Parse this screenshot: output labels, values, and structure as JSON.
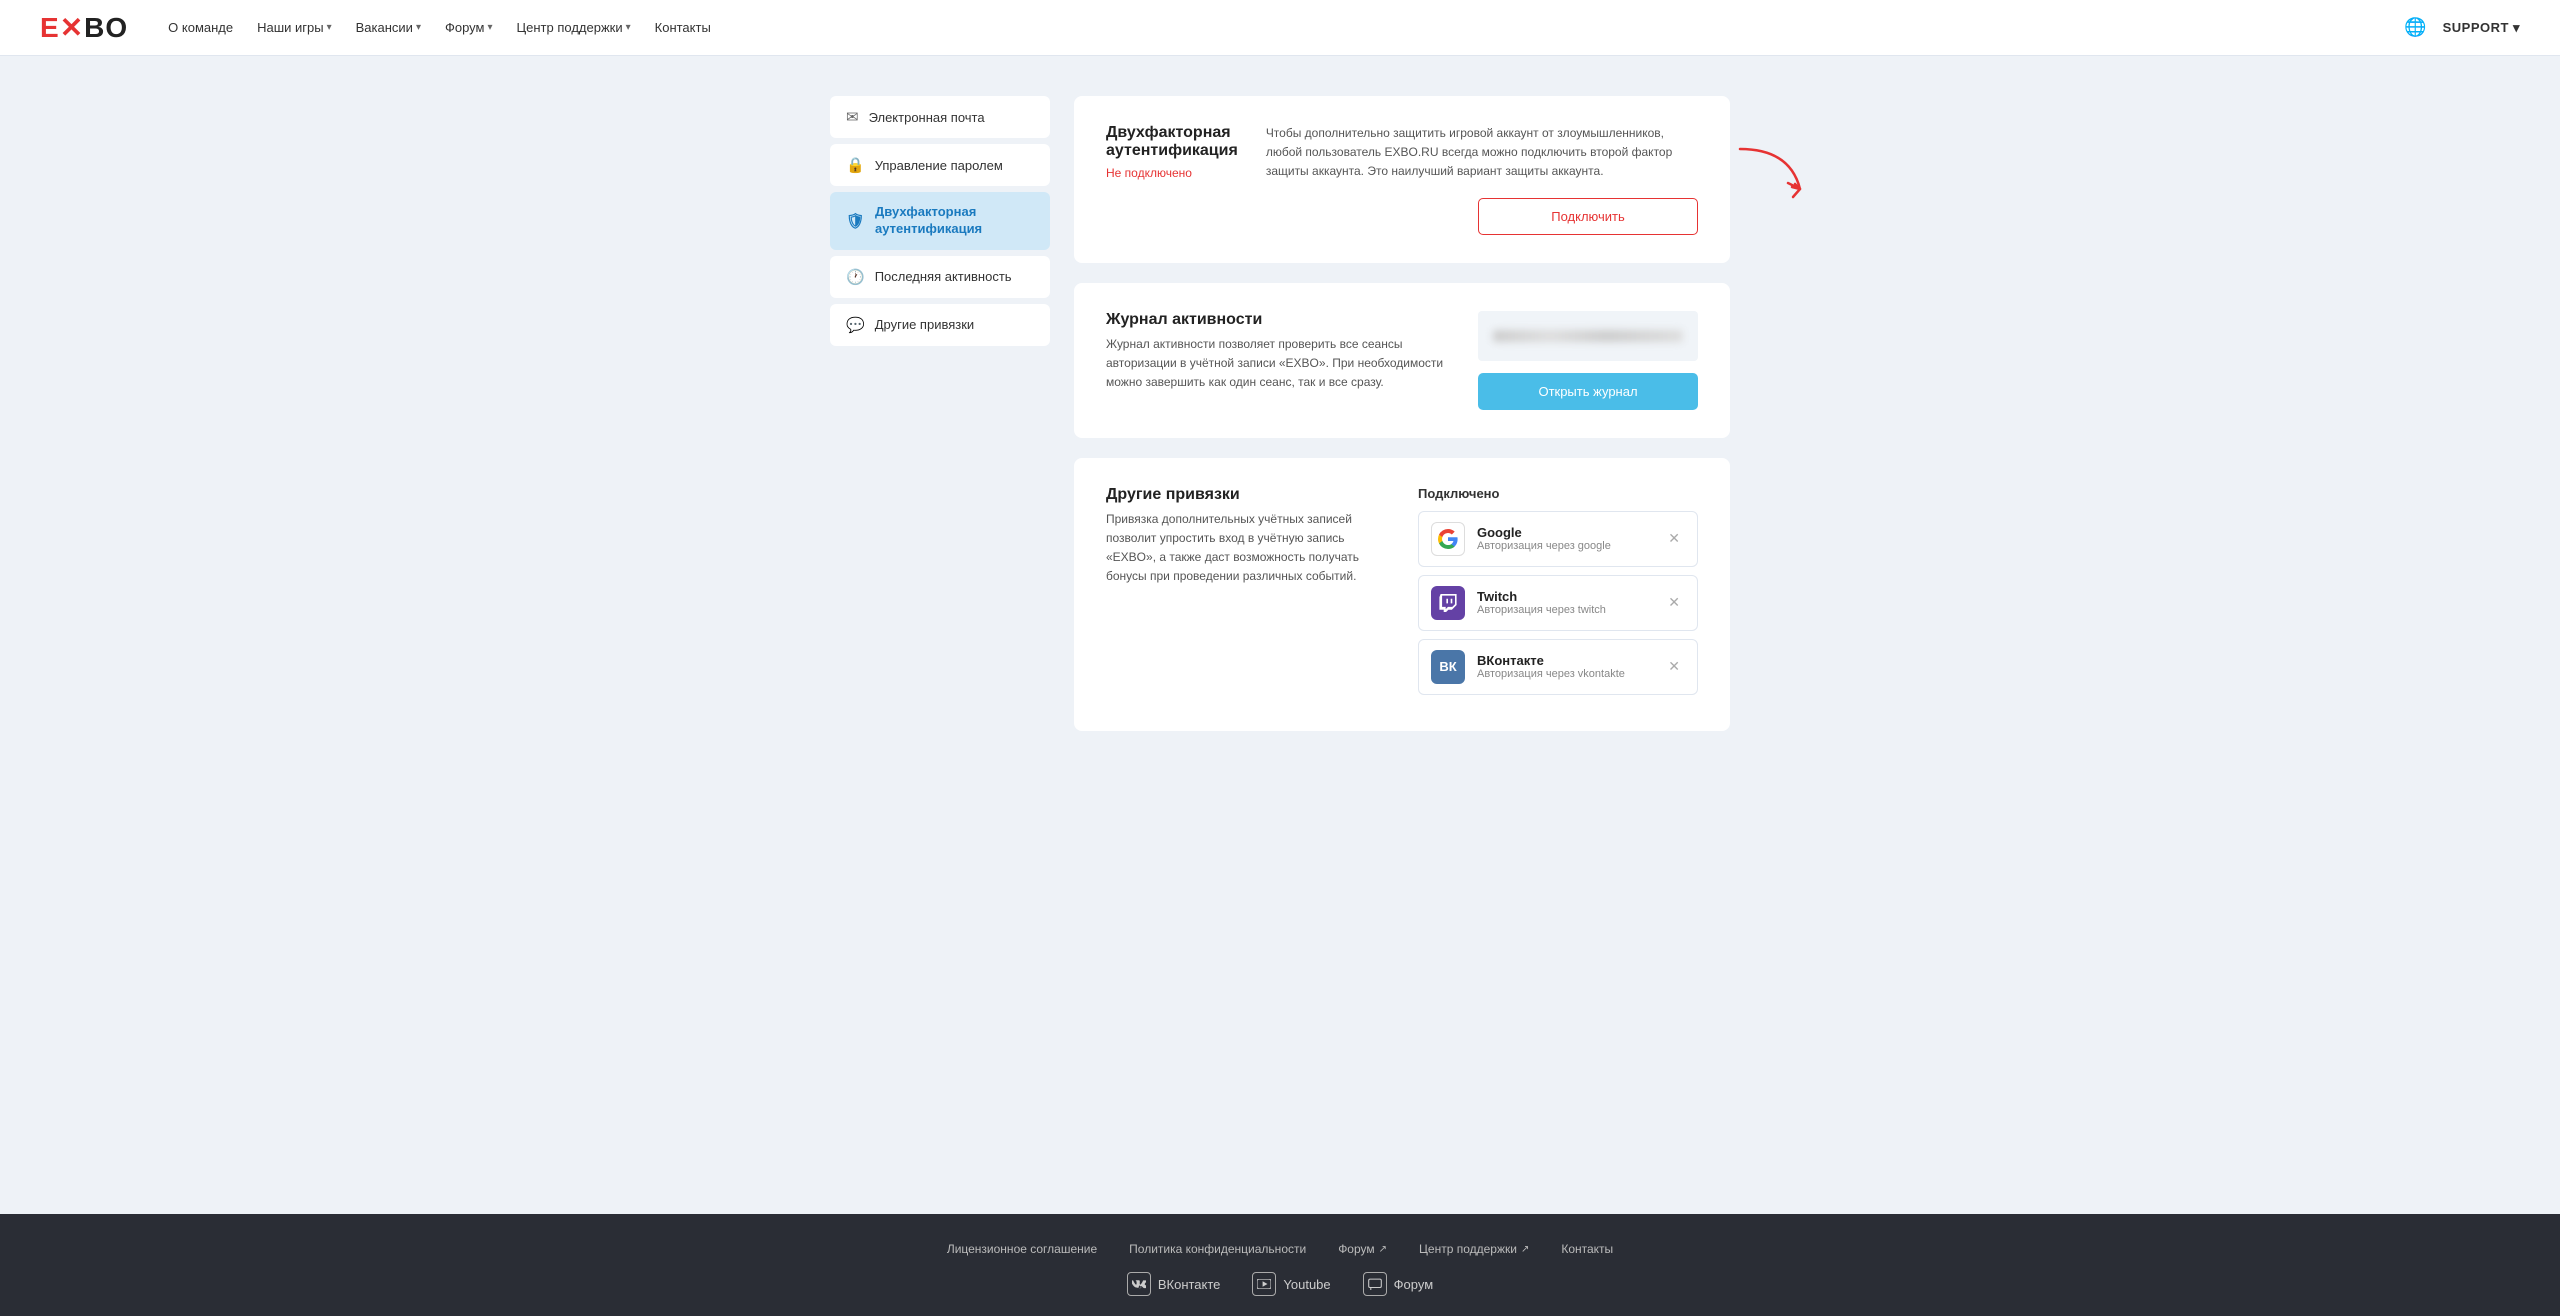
{
  "header": {
    "logo": "EXBO",
    "nav": [
      {
        "label": "О команде",
        "has_arrow": false
      },
      {
        "label": "Наши игры",
        "has_arrow": true
      },
      {
        "label": "Вакансии",
        "has_arrow": true
      },
      {
        "label": "Форум",
        "has_arrow": true
      },
      {
        "label": "Центр поддержки",
        "has_arrow": true
      },
      {
        "label": "Контакты",
        "has_arrow": false
      }
    ],
    "support_label": "SUPPORT"
  },
  "sidebar": {
    "items": [
      {
        "id": "email",
        "label": "Электронная почта",
        "icon": "✉",
        "active": false
      },
      {
        "id": "password",
        "label": "Управление паролем",
        "icon": "🔒",
        "active": false
      },
      {
        "id": "2fa",
        "label": "Двухфакторная аутентификация",
        "icon": "🛡",
        "active": true
      },
      {
        "id": "activity",
        "label": "Последняя активность",
        "icon": "🕐",
        "active": false
      },
      {
        "id": "bindings",
        "label": "Другие привязки",
        "icon": "💬",
        "active": false
      }
    ]
  },
  "cards": {
    "tfa": {
      "title": "Двухфакторная аутентификация",
      "subtitle": "Не подключено",
      "description": "Чтобы дополнительно защитить игровой аккаунт от злоумышленников, любой пользователь EXBO.RU всегда можно подключить второй фактор защиты аккаунта. Это наилучший вариант защиты аккаунта.",
      "connect_btn": "Подключить"
    },
    "activity": {
      "title": "Журнал активности",
      "description": "Журнал активности позволяет проверить все сеансы авторизации в учётной записи «EXBO». При необходимости можно завершить как один сеанс, так и все сразу.",
      "open_btn": "Открыть журнал"
    },
    "bindings": {
      "title": "Другие привязки",
      "description": "Привязка дополнительных учётных записей позволит упростить вход в учётную запись «EXBO», а также даст возможность получать бонусы при проведении различных событий.",
      "connected_label": "Подключено",
      "items": [
        {
          "name": "Google",
          "desc": "Авторизация через google",
          "type": "google"
        },
        {
          "name": "Twitch",
          "desc": "Авторизация через twitch",
          "type": "twitch"
        },
        {
          "name": "ВКонтакте",
          "desc": "Авторизация через vkontakte",
          "type": "vk"
        }
      ]
    }
  },
  "footer": {
    "links": [
      {
        "label": "Лицензионное соглашение"
      },
      {
        "label": "Политика конфиденциальности"
      },
      {
        "label": "Форум",
        "has_arrow": true
      },
      {
        "label": "Центр поддержки",
        "has_arrow": true
      },
      {
        "label": "Контакты"
      }
    ],
    "social": [
      {
        "label": "ВКонтакте",
        "icon": "VK"
      },
      {
        "label": "Youtube",
        "icon": "▶"
      },
      {
        "label": "Форум",
        "icon": "💬"
      }
    ]
  }
}
